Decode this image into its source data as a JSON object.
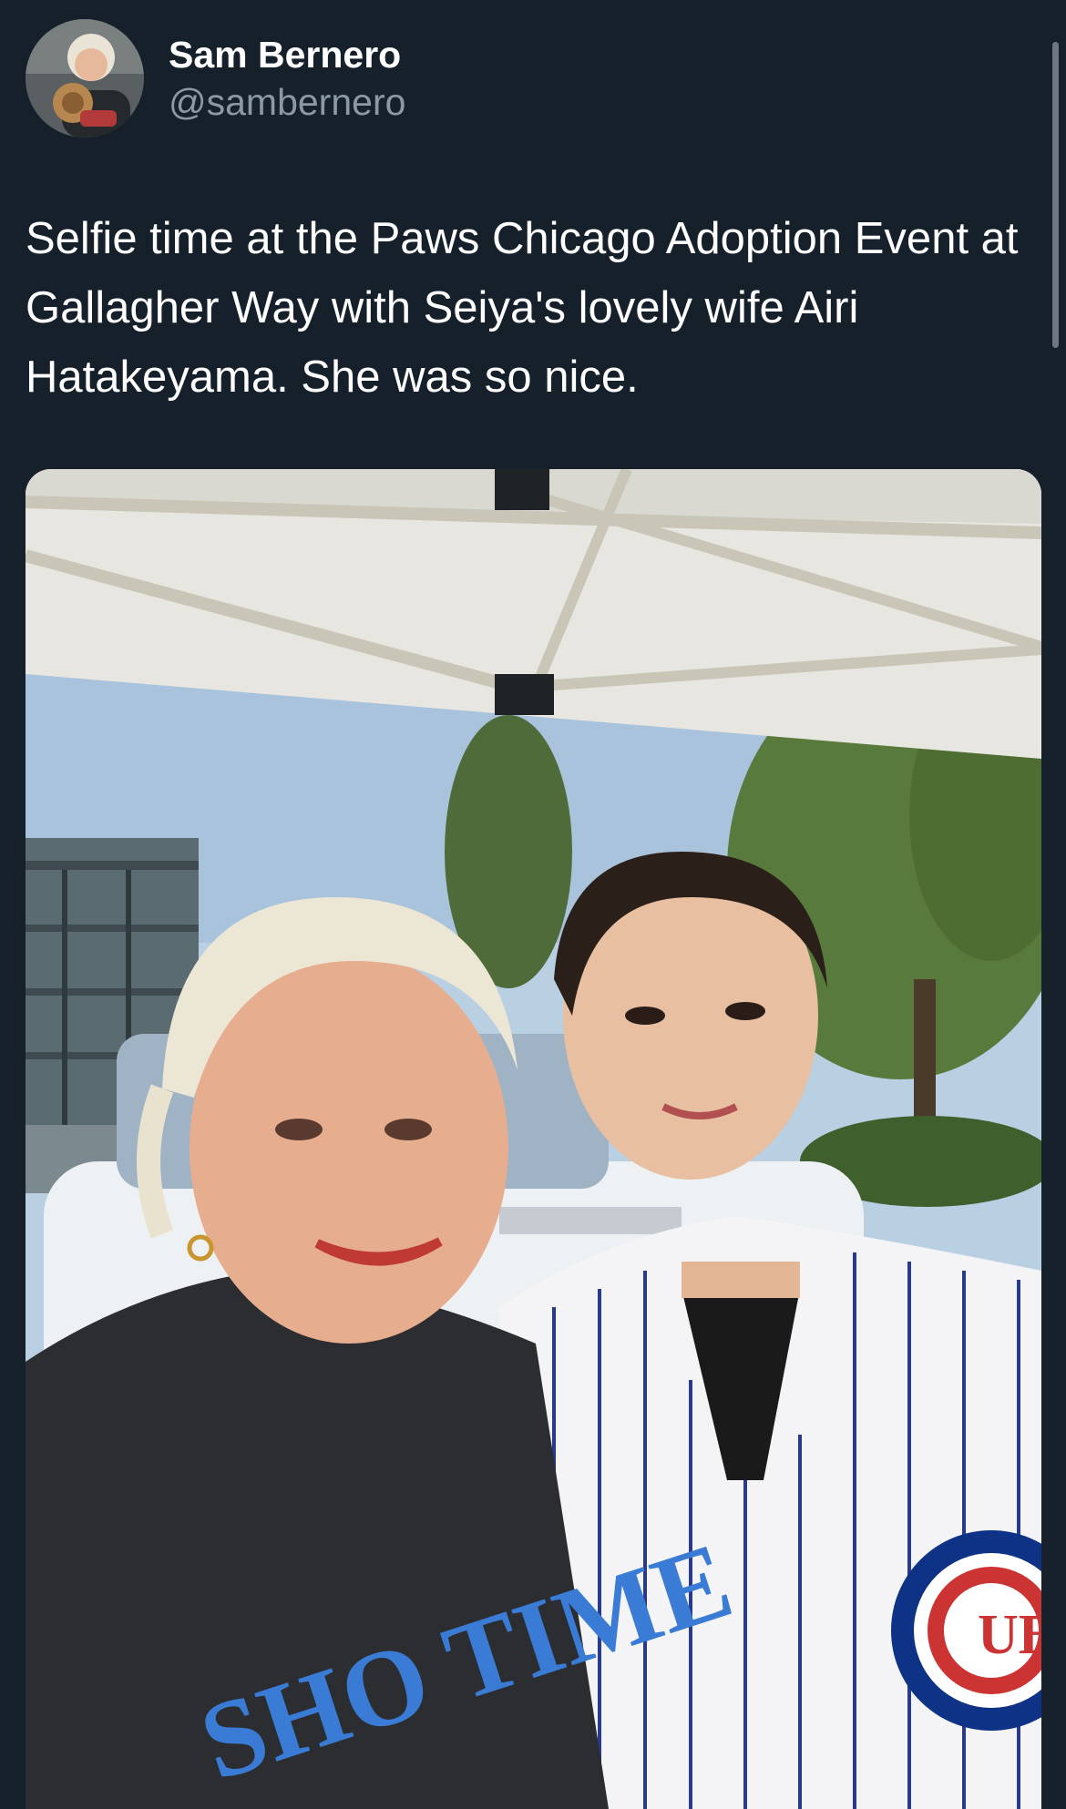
{
  "tweet": {
    "author": {
      "display_name": "Sam Bernero",
      "handle": "@sambernero"
    },
    "text": "Selfie time at the Paws Chicago  Adoption Event at Gallagher Way with Seiya's lovely wife Airi Hatakeyama. She was so nice.",
    "photo": {
      "shirt_text_left": "SHO TIME",
      "jersey_logo_text": "UB"
    }
  },
  "colors": {
    "background": "#15202b",
    "handle_gray": "#8b98a5",
    "cubs_blue": "#0e3386",
    "cubs_red": "#cc3433"
  }
}
